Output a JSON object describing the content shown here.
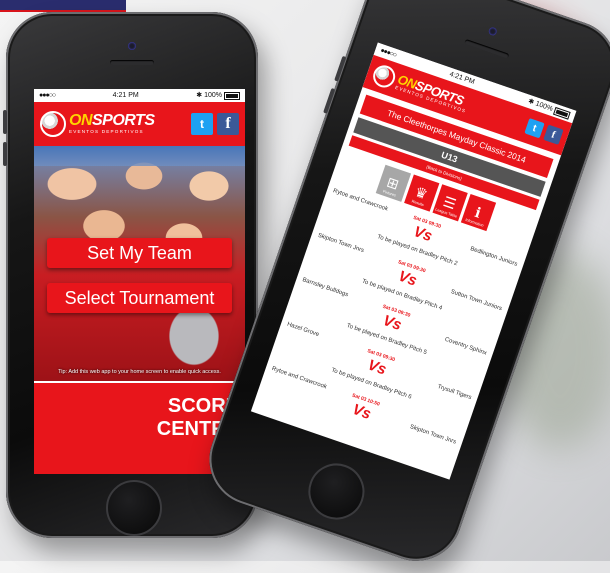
{
  "left_phone": {
    "status": {
      "signal": "●●●○○",
      "time": "4:21 PM",
      "battery": "100%"
    },
    "brand": {
      "word_prefix": "ON",
      "word_rest": "SPORTS",
      "subtitle": "EVENTOS DEPORTIVOS"
    },
    "social": {
      "twitter_glyph": "t",
      "facebook_glyph": "f"
    },
    "buttons": {
      "set_team": "Set My Team",
      "select_tournament": "Select Tournament"
    },
    "tip": "Tip: Add this web app to your home screen to enable quick access.",
    "score_centre": "SCORE\nCENTRE"
  },
  "right_phone": {
    "status": {
      "signal": "●●●○○",
      "time": "4:21 PM",
      "battery": "100%"
    },
    "brand": {
      "word_prefix": "ON",
      "word_rest": "SPORTS",
      "subtitle": "EVENTOS DEPORTIVOS"
    },
    "social": {
      "twitter_glyph": "t",
      "facebook_glyph": "f"
    },
    "event_title": "The Cleethorpes Mayday Classic 2014",
    "group": "U13",
    "back_link": "(Back to Divisions)",
    "tabs": [
      {
        "label": "Fixtures",
        "icon": "pitch-icon"
      },
      {
        "label": "Results",
        "icon": "trophy-icon"
      },
      {
        "label": "League Table",
        "icon": "table-icon"
      },
      {
        "label": "Information",
        "icon": "info-icon"
      }
    ],
    "matches": [
      {
        "home": "Rytoe and Crawcrook",
        "away": "Bedlington Juniors",
        "time": "Sat 03 09:30",
        "vs": "Vs",
        "venue": "To be played on Bradley Pitch 2"
      },
      {
        "home": "Skipton Town Jnrs",
        "away": "Sutton Town Juniors",
        "time": "Sat 03 09:30",
        "vs": "Vs",
        "venue": "To be played on Bradley Pitch 4"
      },
      {
        "home": "Barnsley Bulldogs",
        "away": "Coventry Sphinx",
        "time": "Sat 03 09:30",
        "vs": "Vs",
        "venue": "To be played on Bradley Pitch 5"
      },
      {
        "home": "Hazel Grove",
        "away": "Trysull Tigers",
        "time": "Sat 03 09:30",
        "vs": "Vs",
        "venue": "To be played on Bradley Pitch 6"
      },
      {
        "home": "Rytoe and Crawcrook",
        "away": "Skipton Town Jnrs",
        "time": "Sat 03 10:50",
        "vs": "Vs",
        "venue": ""
      }
    ]
  }
}
